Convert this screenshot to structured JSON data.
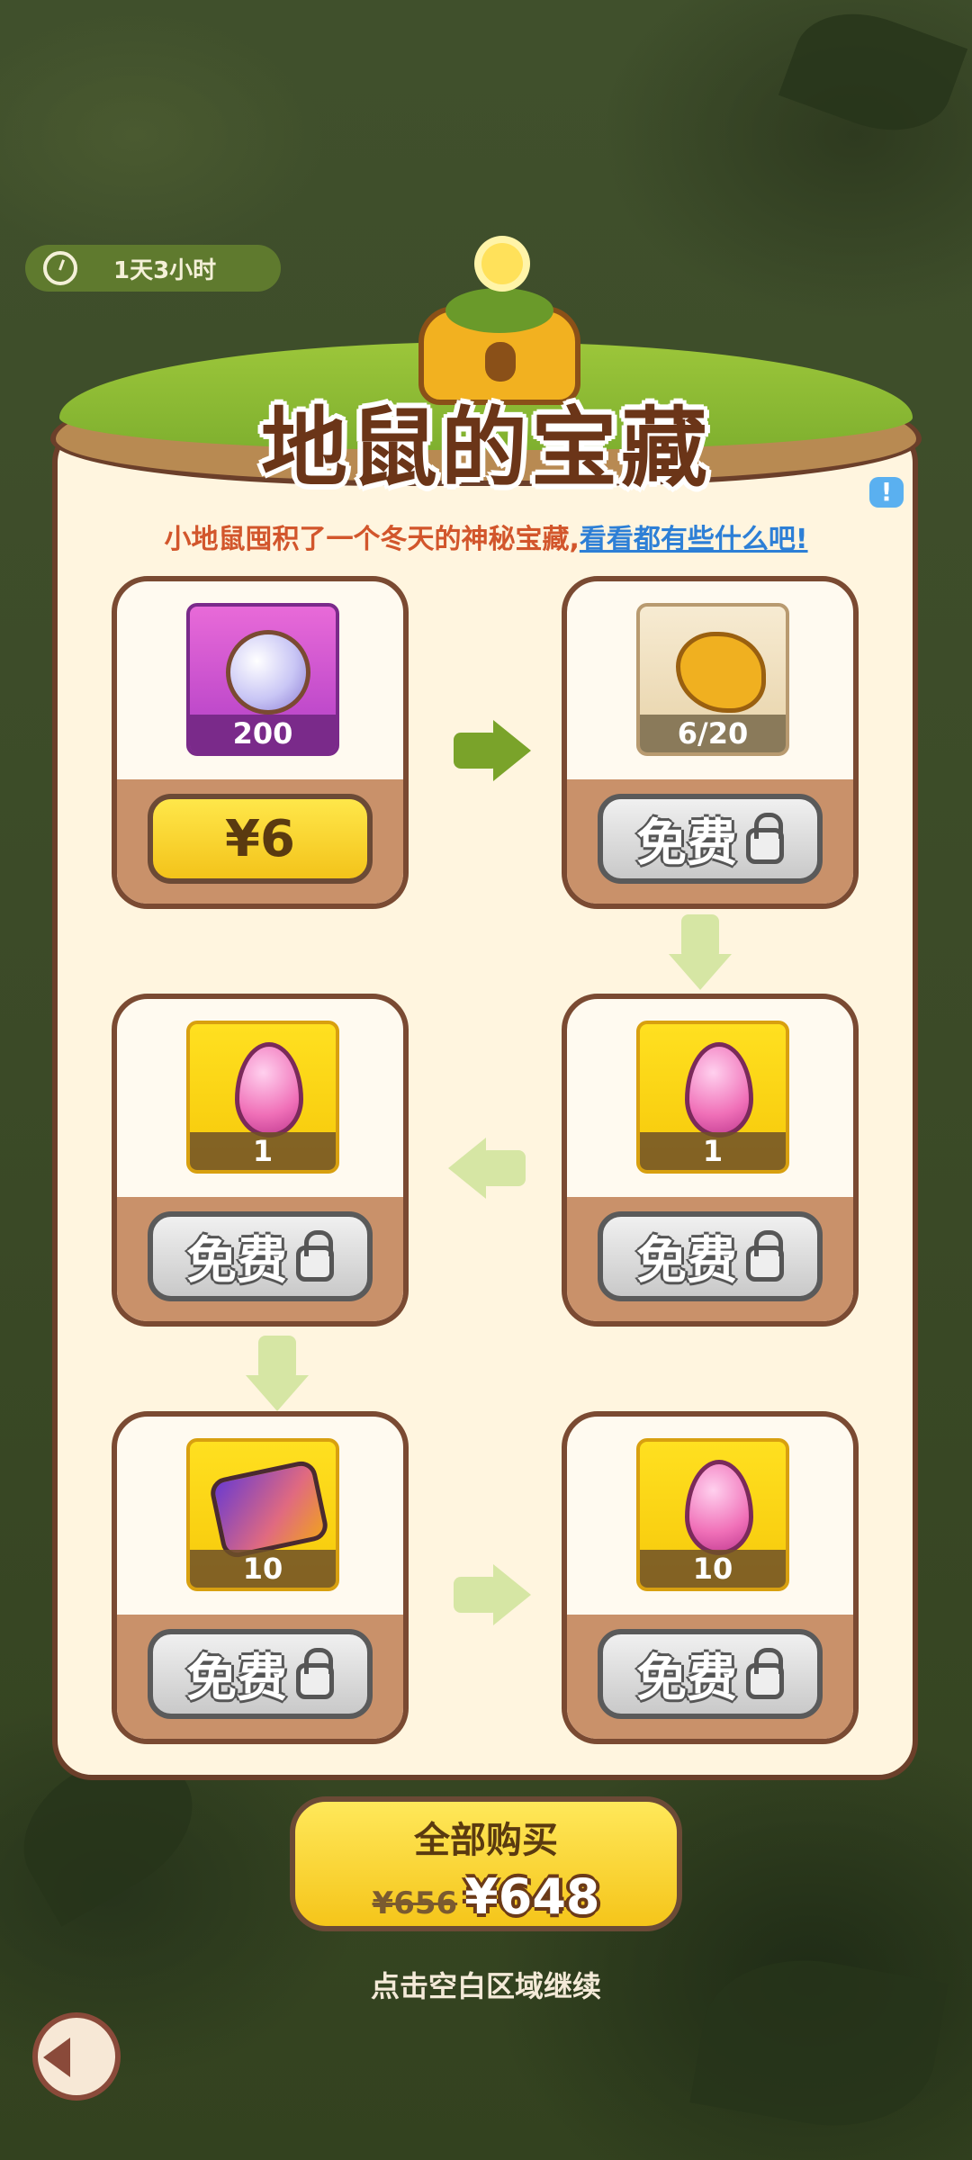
{
  "timer": {
    "text": "1天3小时"
  },
  "panel": {
    "title": "地鼠的宝藏",
    "subtitle_plain": "小地鼠囤积了一个冬天的神秘宝藏,",
    "subtitle_link": "看看都有些什么吧!",
    "info_icon": "!"
  },
  "rewards": [
    {
      "item": "pearl",
      "count": "200",
      "button": "¥6",
      "locked": false
    },
    {
      "item": "golden-chick",
      "count": "6/20",
      "button": "免费",
      "locked": true
    },
    {
      "item": "pink-gem",
      "count": "1",
      "button": "免费",
      "locked": true
    },
    {
      "item": "pink-gem",
      "count": "1",
      "button": "免费",
      "locked": true
    },
    {
      "item": "puzzle-piece",
      "count": "10",
      "button": "免费",
      "locked": true
    },
    {
      "item": "pink-gem",
      "count": "10",
      "button": "免费",
      "locked": true
    }
  ],
  "buy_all": {
    "label": "全部购买",
    "old_price": "¥656",
    "new_price": "¥648"
  },
  "continue_hint": "点击空白区域继续",
  "colors": {
    "panel_bg": "#fff5df",
    "panel_border": "#6b3f2a",
    "yellow_button": "#f3c31a",
    "arrow_active": "#7aa32a",
    "arrow_inactive": "#d6e6a4",
    "link_blue": "#2d7fd6",
    "subtitle_red": "#d2562c"
  }
}
